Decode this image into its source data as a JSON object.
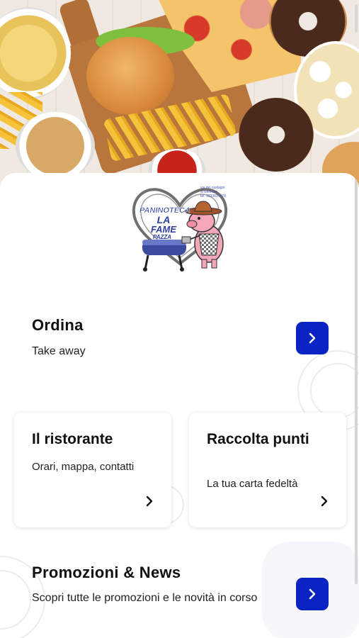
{
  "hero": {
    "alt_icon": "food-photo"
  },
  "logo": {
    "line1": "PANINOTECA",
    "line2": "LA",
    "line3": "FAME",
    "line4": "PAZZA",
    "small_text": [
      "via dei castagni",
      "S.Gennaro",
      "tel. 3333037978"
    ],
    "icon": "pig-grill-logo"
  },
  "ordina": {
    "title": "Ordina",
    "subtitle": "Take away",
    "button_icon": "chevron-right-icon"
  },
  "cards": [
    {
      "title": "Il ristorante",
      "subtitle": "Orari, mappa, contatti",
      "icon": "chevron-right-icon"
    },
    {
      "title": "Raccolta punti",
      "subtitle": "La tua carta fedeltà",
      "icon": "chevron-right-icon"
    }
  ],
  "promozioni": {
    "title": "Promozioni & News",
    "subtitle": "Scopri tutte le promozioni e le novità in corso",
    "button_icon": "chevron-right-icon"
  },
  "colors": {
    "accent": "#0a24c4",
    "text": "#111111",
    "background": "#ffffff"
  }
}
